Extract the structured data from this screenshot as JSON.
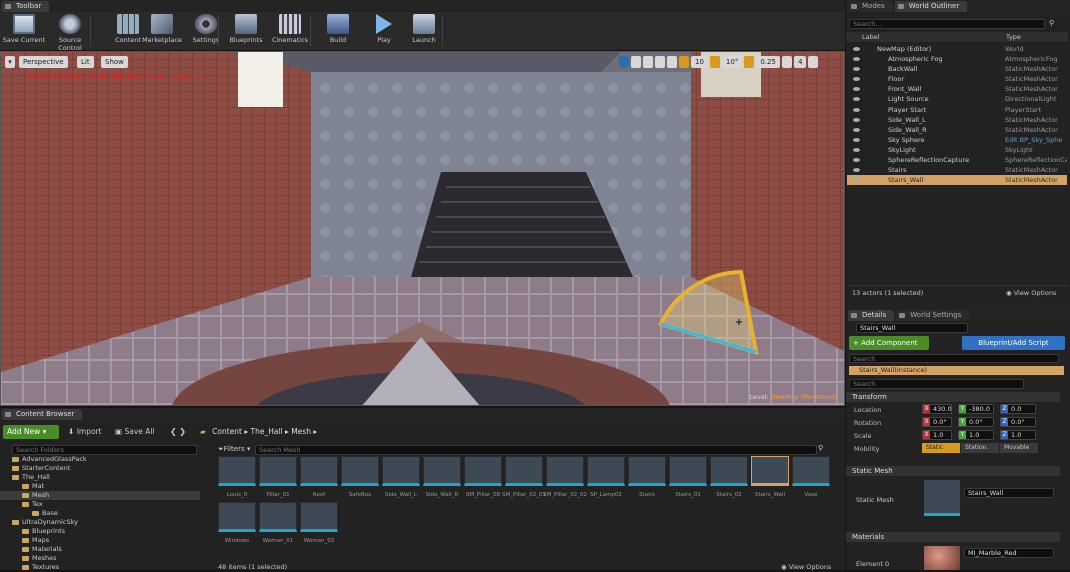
{
  "toolbar": {
    "tab": "Toolbar",
    "buttons": [
      {
        "label": "Save Current",
        "icon": "save-icon"
      },
      {
        "label": "Source Control",
        "icon": "source-control-icon"
      },
      {
        "label": "Content",
        "icon": "content-icon"
      },
      {
        "label": "Marketplace",
        "icon": "marketplace-icon"
      },
      {
        "label": "Settings",
        "icon": "settings-icon"
      },
      {
        "label": "Blueprints",
        "icon": "blueprints-icon"
      },
      {
        "label": "Cinematics",
        "icon": "cinematics-icon"
      },
      {
        "label": "Build",
        "icon": "build-icon"
      },
      {
        "label": "Play",
        "icon": "play-icon"
      },
      {
        "label": "Launch",
        "icon": "launch-icon"
      }
    ]
  },
  "viewport": {
    "perspective": "Perspective",
    "lit": "Lit",
    "show": "Show",
    "warning": "LIGHTING NEEDS TO BE REBUILT (7 unbuilt objects)",
    "grid_snap": "10",
    "rot_snap": "10°",
    "scale_snap": "0.25",
    "cam_speed": "4",
    "level_label": "Level:",
    "level_name": "NewMap (Persistent)"
  },
  "outliner": {
    "tab_modes": "Modes",
    "tab_outliner": "World Outliner",
    "search_placeholder": "Search...",
    "col_label": "Label",
    "col_type": "Type",
    "rows": [
      {
        "label": "NewMap (Editor)",
        "type": "World"
      },
      {
        "label": "Atmospheric Fog",
        "type": "AtmosphericFog"
      },
      {
        "label": "BackWall",
        "type": "StaticMeshActor"
      },
      {
        "label": "Floor",
        "type": "StaticMeshActor"
      },
      {
        "label": "Front_Wall",
        "type": "StaticMeshActor"
      },
      {
        "label": "Light Source",
        "type": "DirectionalLight"
      },
      {
        "label": "Player Start",
        "type": "PlayerStart"
      },
      {
        "label": "Side_Wall_L",
        "type": "StaticMeshActor"
      },
      {
        "label": "Side_Wall_R",
        "type": "StaticMeshActor"
      },
      {
        "label": "Sky Sphere",
        "type": "Edit BP_Sky_Sphe"
      },
      {
        "label": "SkyLight",
        "type": "SkyLight"
      },
      {
        "label": "SphereReflectionCapture",
        "type": "SphereReflectionCa"
      },
      {
        "label": "Stairs",
        "type": "StaticMeshActor"
      },
      {
        "label": "Stairs_Wall",
        "type": "StaticMeshActor"
      }
    ],
    "count": "13 actors (1 selected)",
    "view_options": "View Options"
  },
  "details": {
    "tab_details": "Details",
    "tab_world": "World Settings",
    "name": "Stairs_Wall",
    "add_component": "+ Add Component",
    "blueprint_script": "Blueprint/Add Script",
    "search_placeholder": "Search",
    "instance": "Stairs_Wall(Instance)",
    "transform": "Transform",
    "location": "Location",
    "rotation": "Rotation",
    "scale": "Scale",
    "mobility": "Mobility",
    "loc": [
      "430.0",
      "-380.0",
      "0.0"
    ],
    "rot": [
      "0.0°",
      "0.0°",
      "0.0°"
    ],
    "scl": [
      "1.0",
      "1.0",
      "1.0"
    ],
    "mob_static": "Static",
    "mob_stationary": "Station.",
    "mob_movable": "Movable",
    "static_mesh_section": "Static Mesh",
    "static_mesh_label": "Static Mesh",
    "static_mesh_value": "Stairs_Wall",
    "materials_section": "Materials",
    "element0": "Element 0",
    "material_value": "MI_Marble_Red"
  },
  "content_browser": {
    "tab": "Content Browser",
    "add_new": "Add New",
    "import": "Import",
    "save_all": "Save All",
    "path": [
      "Content",
      "The_Hall",
      "Mesh"
    ],
    "search_folders": "Search Folders",
    "filters": "Filters",
    "search_mesh": "Search Mesh",
    "tree": [
      {
        "label": "AdvancedGlassPack",
        "level": 0
      },
      {
        "label": "StarterContent",
        "level": 0
      },
      {
        "label": "The_Hall",
        "level": 0
      },
      {
        "label": "Mat",
        "level": 1
      },
      {
        "label": "Mesh",
        "level": 1
      },
      {
        "label": "Tex",
        "level": 1
      },
      {
        "label": "Base",
        "level": 2
      },
      {
        "label": "UltraDynamicSky",
        "level": 0
      },
      {
        "label": "Blueprints",
        "level": 1
      },
      {
        "label": "Maps",
        "level": 1
      },
      {
        "label": "Materials",
        "level": 1
      },
      {
        "label": "Meshes",
        "level": 1
      },
      {
        "label": "Textures",
        "level": 1
      }
    ],
    "assets_row1": [
      "Louis_0",
      "Pillar_01",
      "Roof",
      "SafeBox",
      "Side_Wall_L",
      "Side_Wall_R",
      "SM_Pillar_08",
      "SM_Pillar_02_01",
      "SM_Pillar_02_02",
      "SP_Lamp02",
      "Stairs",
      "Stairs_01",
      "Stairs_02",
      "Stairs_Wall",
      "Vase"
    ],
    "assets_row2": [
      "Windows",
      "Woman_01",
      "Woman_02"
    ],
    "item_count": "48 items (1 selected)",
    "view_options": "View Options"
  },
  "colors": {
    "accent": "#d3a365",
    "add_green": "#4a8c26",
    "blue_btn": "#2f72c4",
    "asset_bar": "#19a8c8"
  }
}
